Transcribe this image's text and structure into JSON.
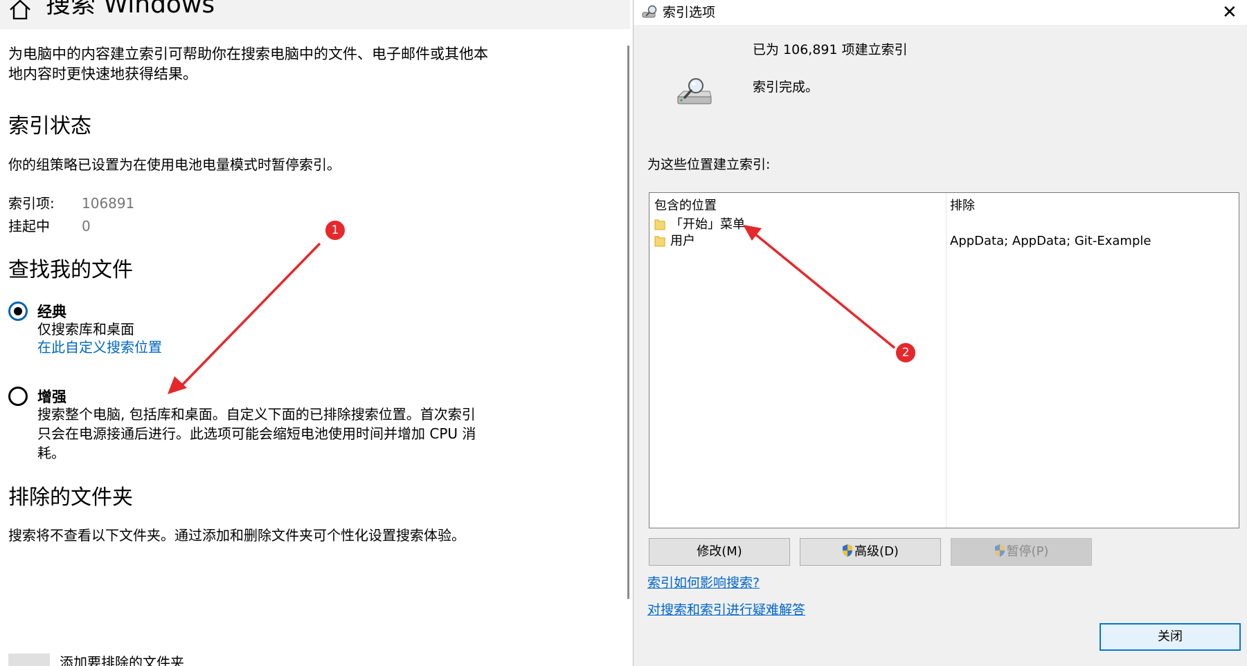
{
  "settings": {
    "title": "搜索 Windows",
    "intro": "为电脑中的内容建立索引可帮助你在搜索电脑中的文件、电子邮件或其他本地内容时更快速地获得结果。",
    "index_status": {
      "heading": "索引状态",
      "policy_note": "你的组策略已设置为在使用电池电量模式时暂停索引。",
      "indexed_label": "索引项:",
      "indexed_value": "106891",
      "pending_label": "挂起中",
      "pending_value": "0"
    },
    "find_files": {
      "heading": "查找我的文件",
      "classic": {
        "label": "经典",
        "desc": "仅搜索库和桌面",
        "link": "在此自定义搜索位置",
        "selected": true
      },
      "enhanced": {
        "label": "增强",
        "desc": "搜索整个电脑, 包括库和桌面。自定义下面的已排除搜索位置。首次索引只会在电源接通后进行。此选项可能会缩短电池使用时间并增加 CPU 消耗。",
        "selected": false
      }
    },
    "excluded": {
      "heading": "排除的文件夹",
      "desc": "搜索将不查看以下文件夹。通过添加和删除文件夹可个性化设置搜索体验。",
      "add_label": "添加要排除的文件夹"
    }
  },
  "dialog": {
    "title": "索引选项",
    "status_count": "已为 106,891 项建立索引",
    "status_state": "索引完成。",
    "locations_caption": "为这些位置建立索引:",
    "columns": {
      "included": "包含的位置",
      "excluded": "排除"
    },
    "rows": [
      {
        "name": "「开始」菜单",
        "exclude": ""
      },
      {
        "name": "用户",
        "exclude": "AppData; AppData; Git-Example"
      }
    ],
    "buttons": {
      "modify": "修改(M)",
      "advanced": "高级(D)",
      "pause": "暂停(P)",
      "close": "关闭"
    },
    "links": {
      "how_affects": "索引如何影响搜索?",
      "troubleshoot": "对搜索和索引进行疑难解答"
    }
  },
  "annotations": {
    "badge1": "1",
    "badge2": "2",
    "color": "#e6272b"
  },
  "colors": {
    "accent": "#0067c0",
    "dialog_bg": "#f0f0f0",
    "button_bg": "#e1e1e1"
  }
}
